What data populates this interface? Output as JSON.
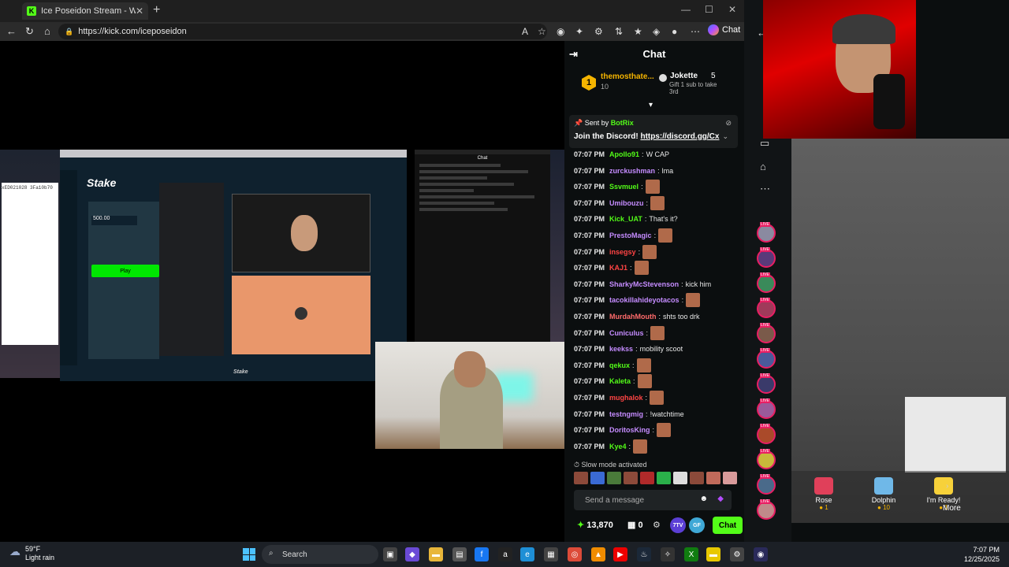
{
  "browser": {
    "tab_title": "Ice Poseidon Stream - Watch",
    "tab_favicon": "K",
    "new_tab": "+",
    "url": "https://kick.com/iceposeidon",
    "copilot_label": "Chat"
  },
  "stream": {
    "code_text": "xED021028 3Fa10b70",
    "stake_logo": "Stake",
    "stake_amount": "500.00",
    "stake_play": "Play",
    "stake_footer": "Stake",
    "minichat_title": "Chat"
  },
  "chat": {
    "header": "Chat",
    "leaderboard": {
      "first_rank": "1",
      "first_name": "themosthate...",
      "first_count": "10",
      "second_name": "Jokette",
      "second_count": "5",
      "gift_note": "Gift 1 sub to take 3rd"
    },
    "pinned": {
      "sent_by": "Sent by",
      "bot": "BotRix",
      "message": "Join the Discord!",
      "link": "https://discord.gg/Cx"
    },
    "messages": [
      {
        "time": "07:07 PM",
        "user": "Apollo91",
        "text": "W CAP",
        "color": "#53fc18",
        "emote": false
      },
      {
        "time": "07:07 PM",
        "user": "zurckushman",
        "text": "lma",
        "color": "#c58cff",
        "emote": false
      },
      {
        "time": "07:07 PM",
        "user": "Ssvmuel",
        "text": "",
        "color": "#53fc18",
        "emote": true
      },
      {
        "time": "07:07 PM",
        "user": "Umibouzu",
        "text": "",
        "color": "#c58cff",
        "emote": true
      },
      {
        "time": "07:07 PM",
        "user": "Kick_UAT",
        "text": "That's it?",
        "color": "#53fc18",
        "emote": false
      },
      {
        "time": "07:07 PM",
        "user": "PrestoMagic",
        "text": "",
        "color": "#c58cff",
        "emote": true
      },
      {
        "time": "07:07 PM",
        "user": "insegsy",
        "text": "",
        "color": "#ff4444",
        "emote": true
      },
      {
        "time": "07:07 PM",
        "user": "KAJ1",
        "text": "",
        "color": "#ff4444",
        "emote": true
      },
      {
        "time": "07:07 PM",
        "user": "SharkyMcStevenson",
        "text": "kick him",
        "color": "#c58cff",
        "emote": false
      },
      {
        "time": "07:07 PM",
        "user": "tacokillahideyotacos",
        "text": "",
        "color": "#c58cff",
        "emote": true
      },
      {
        "time": "07:07 PM",
        "user": "MurdahMouth",
        "text": "shts too drk",
        "color": "#ff6b6b",
        "emote": false
      },
      {
        "time": "07:07 PM",
        "user": "Cuniculus",
        "text": "",
        "color": "#c58cff",
        "emote": true
      },
      {
        "time": "07:07 PM",
        "user": "keekss",
        "text": "mobility scoot",
        "color": "#c58cff",
        "emote": false
      },
      {
        "time": "07:07 PM",
        "user": "qekux",
        "text": "",
        "color": "#53fc18",
        "emote": true
      },
      {
        "time": "07:07 PM",
        "user": "Kaleta",
        "text": "",
        "color": "#53fc18",
        "emote": true
      },
      {
        "time": "07:07 PM",
        "user": "mughalok",
        "text": "",
        "color": "#ff4444",
        "emote": true
      },
      {
        "time": "07:07 PM",
        "user": "testngmig",
        "text": "!watchtime",
        "color": "#c58cff",
        "emote": false
      },
      {
        "time": "07:07 PM",
        "user": "DoritosKing",
        "text": "",
        "color": "#c58cff",
        "emote": true
      },
      {
        "time": "07:07 PM",
        "user": "Kye4",
        "text": "",
        "color": "#53fc18",
        "emote": true
      }
    ],
    "slow_mode": "Slow mode activated",
    "send_placeholder": "Send a message",
    "points": "13,870",
    "claims": "0",
    "ext1": "7TV",
    "ext2": "GF",
    "send_label": "Chat"
  },
  "side": {
    "gifts": [
      {
        "name": "Rose",
        "cost": "1",
        "color": "#e0405a"
      },
      {
        "name": "Dolphin",
        "cost": "10",
        "color": "#6fb8e8"
      },
      {
        "name": "I'm Ready!",
        "cost": "1",
        "color": "#f7d13a"
      }
    ],
    "more_label": "More"
  },
  "taskbar": {
    "temp": "59°F",
    "condition": "Light rain",
    "search": "Search",
    "time": "7:07 PM",
    "date": "12/25/2025"
  },
  "colors": {
    "kick_green": "#53fc18",
    "gold": "#f5b400"
  }
}
